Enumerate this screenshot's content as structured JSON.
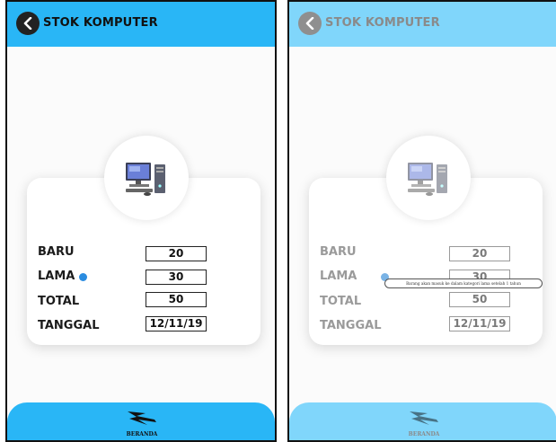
{
  "left_screen": {
    "header": {
      "title": "STOK KOMPUTER"
    },
    "rows": [
      {
        "label": "BARU",
        "value": "20"
      },
      {
        "label": "LAMA",
        "value": "30"
      },
      {
        "label": "TOTAL",
        "value": "50"
      },
      {
        "label": "TANGGAL",
        "value": "12/11/19"
      }
    ],
    "footer": {
      "label": "BERANDA"
    }
  },
  "right_screen": {
    "header": {
      "title": "STOK KOMPUTER"
    },
    "rows": [
      {
        "label": "BARU",
        "value": "20"
      },
      {
        "label": "LAMA",
        "value": "30"
      },
      {
        "label": "TOTAL",
        "value": "50"
      },
      {
        "label": "TANGGAL",
        "value": "12/11/19"
      }
    ],
    "tooltip": "Barang akan masuk ke dalam kategori lama setelah 1 tahun",
    "footer": {
      "label": "BERANDA"
    }
  },
  "icons": {
    "back": "back-arrow-icon",
    "computer": "computer-icon",
    "home": "beranda-logo-icon",
    "info": "info-dot-icon"
  },
  "colors": {
    "accent": "#29b6f6",
    "accent_faded": "#80d6fb",
    "info_dot": "#2a8ce0"
  }
}
